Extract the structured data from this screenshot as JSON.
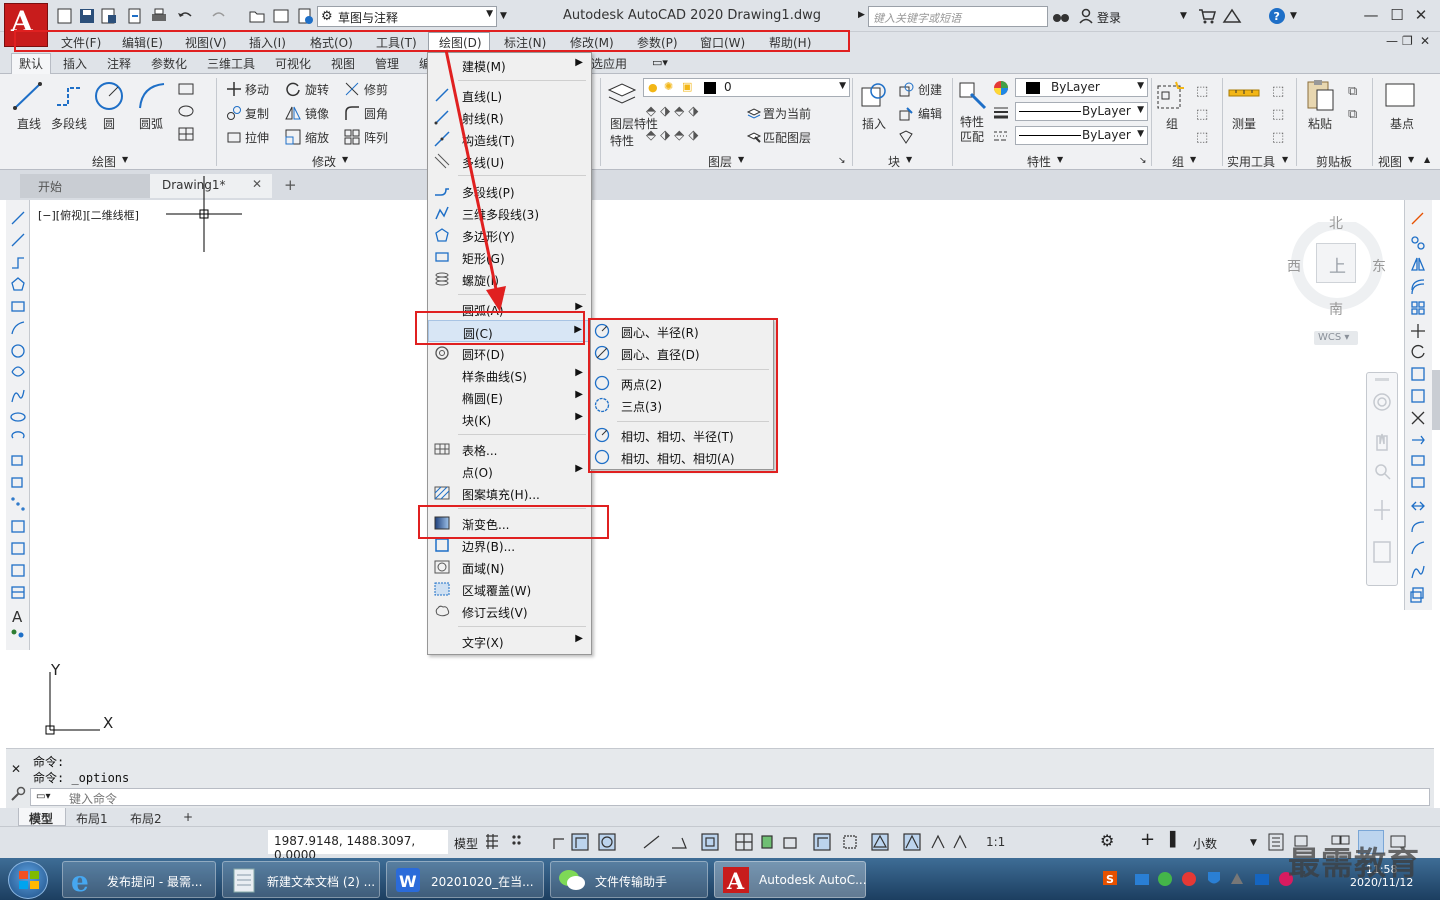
{
  "app": {
    "logo_letter": "A",
    "workspace": "草图与注释",
    "title": "Autodesk AutoCAD 2020    Drawing1.dwg",
    "search_placeholder": "键入关键字或短语",
    "login": "登录"
  },
  "menubar": {
    "items": [
      "文件(F)",
      "编辑(E)",
      "视图(V)",
      "插入(I)",
      "格式(O)",
      "工具(T)",
      "绘图(D)",
      "标注(N)",
      "修改(M)",
      "参数(P)",
      "窗口(W)",
      "帮助(H)"
    ]
  },
  "ribbon": {
    "tabs": [
      "默认",
      "插入",
      "注释",
      "参数化",
      "三维工具",
      "可视化",
      "视图",
      "管理",
      "编",
      "选应用"
    ],
    "draw_panel": {
      "title": "绘图",
      "tools": [
        "直线",
        "多段线",
        "圆",
        "圆弧"
      ]
    },
    "modify_panel": {
      "title": "修改",
      "tools": [
        "移动",
        "旋转",
        "修剪",
        "复制",
        "镜像",
        "圆角",
        "拉伸",
        "缩放",
        "阵列"
      ]
    },
    "layer_panel": {
      "title": "图层",
      "big": "图层特性",
      "big2": "特性",
      "current_layer": "0",
      "tools": [
        "置为当前",
        "匹配图层"
      ]
    },
    "block_panel": {
      "title": "块",
      "tools": [
        "插入",
        "创建",
        "编辑"
      ]
    },
    "props_panel": {
      "title": "特性",
      "big": "特性匹配",
      "bylayer": [
        "ByLayer",
        "ByLayer",
        "ByLayer"
      ]
    },
    "group_panel": {
      "title": "组",
      "tool": "组"
    },
    "utils_panel": {
      "title": "实用工具",
      "tool": "测量"
    },
    "clip_panel": {
      "title": "剪贴板",
      "tool": "粘贴"
    },
    "view_panel": {
      "title": "视图",
      "tool": "基点"
    }
  },
  "filetabs": {
    "start": "开始",
    "drawing": "Drawing1*"
  },
  "viewport": {
    "label": "[−][俯视][二维线框]",
    "compass": {
      "n": "北",
      "s": "南",
      "e": "东",
      "w": "西",
      "face": "上"
    },
    "wcs": "WCS ▾",
    "ucs_x": "X",
    "ucs_y": "Y"
  },
  "draw_menu": {
    "items": [
      {
        "label": "建模(M)",
        "arrow": true
      },
      {
        "label": "直线(L)"
      },
      {
        "label": "射线(R)"
      },
      {
        "label": "构造线(T)"
      },
      {
        "label": "多线(U)"
      },
      {
        "label": "多段线(P)"
      },
      {
        "label": "三维多段线(3)"
      },
      {
        "label": "多边形(Y)"
      },
      {
        "label": "矩形(G)"
      },
      {
        "label": "螺旋(I)"
      },
      {
        "label": "圆弧(A)",
        "arrow": true
      },
      {
        "label": "圆(C)",
        "arrow": true
      },
      {
        "label": "圆环(D)"
      },
      {
        "label": "样条曲线(S)",
        "arrow": true
      },
      {
        "label": "椭圆(E)",
        "arrow": true
      },
      {
        "label": "块(K)",
        "arrow": true
      },
      {
        "label": "表格..."
      },
      {
        "label": "点(O)",
        "arrow": true
      },
      {
        "label": "图案填充(H)..."
      },
      {
        "label": "渐变色..."
      },
      {
        "label": "边界(B)..."
      },
      {
        "label": "面域(N)"
      },
      {
        "label": "区域覆盖(W)"
      },
      {
        "label": "修订云线(V)"
      },
      {
        "label": "文字(X)",
        "arrow": true
      }
    ]
  },
  "circle_menu": {
    "items": [
      "圆心、半径(R)",
      "圆心、直径(D)",
      "两点(2)",
      "三点(3)",
      "相切、相切、半径(T)",
      "相切、相切、相切(A)"
    ]
  },
  "command": {
    "history": [
      "命令:",
      "命令:  _options"
    ],
    "placeholder": "键入命令"
  },
  "layout_tabs": [
    "模型",
    "布局1",
    "布局2",
    "+"
  ],
  "status": {
    "coords": "1987.9148, 1488.3097, 0.0000",
    "model": "模型",
    "scale": "1:1",
    "units": "小数"
  },
  "taskbar": {
    "tasks": [
      "发布提问 - 最需...",
      "新建文本文档 (2) ...",
      "20201020_在当...",
      "文件传输助手",
      "Autodesk AutoC..."
    ],
    "time": "11:58",
    "date": "2020/11/12"
  },
  "watermark": "最需教育",
  "colors": {
    "highlight_red": "#e02020",
    "logo_red": "#c81c1c",
    "menu_hover": "#d8e6f5"
  }
}
